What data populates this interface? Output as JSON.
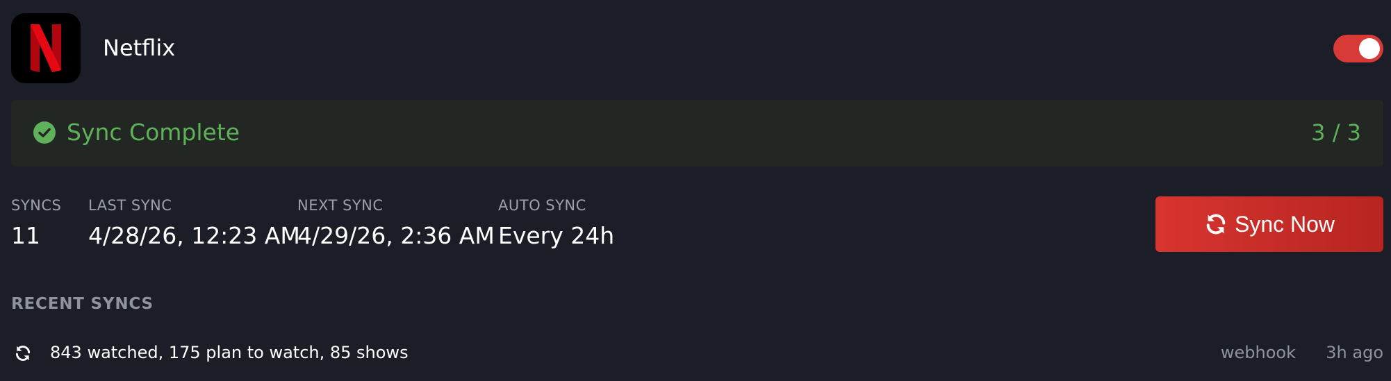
{
  "service": {
    "name": "Netflix",
    "logo_letter": "N",
    "enabled": true,
    "accent_color": "#d83a37"
  },
  "status": {
    "label": "Sync Complete",
    "count": "3 / 3",
    "icon": "check-circle-icon",
    "color": "#5fb15a"
  },
  "stats": [
    {
      "label": "SYNCS",
      "value": "11"
    },
    {
      "label": "LAST SYNC",
      "value": "4/28/26, 12:23 AM"
    },
    {
      "label": "NEXT SYNC",
      "value": "4/29/26, 2:36 AM"
    },
    {
      "label": "AUTO SYNC",
      "value": "Every 24h"
    }
  ],
  "sync_button": {
    "label": "Sync Now",
    "icon": "refresh-icon"
  },
  "recent_syncs": {
    "title": "RECENT SYNCS",
    "items": [
      {
        "icon": "refresh-icon",
        "summary": "843 watched, 175 plan to watch, 85 shows",
        "source": "webhook",
        "time": "3h ago"
      }
    ]
  }
}
